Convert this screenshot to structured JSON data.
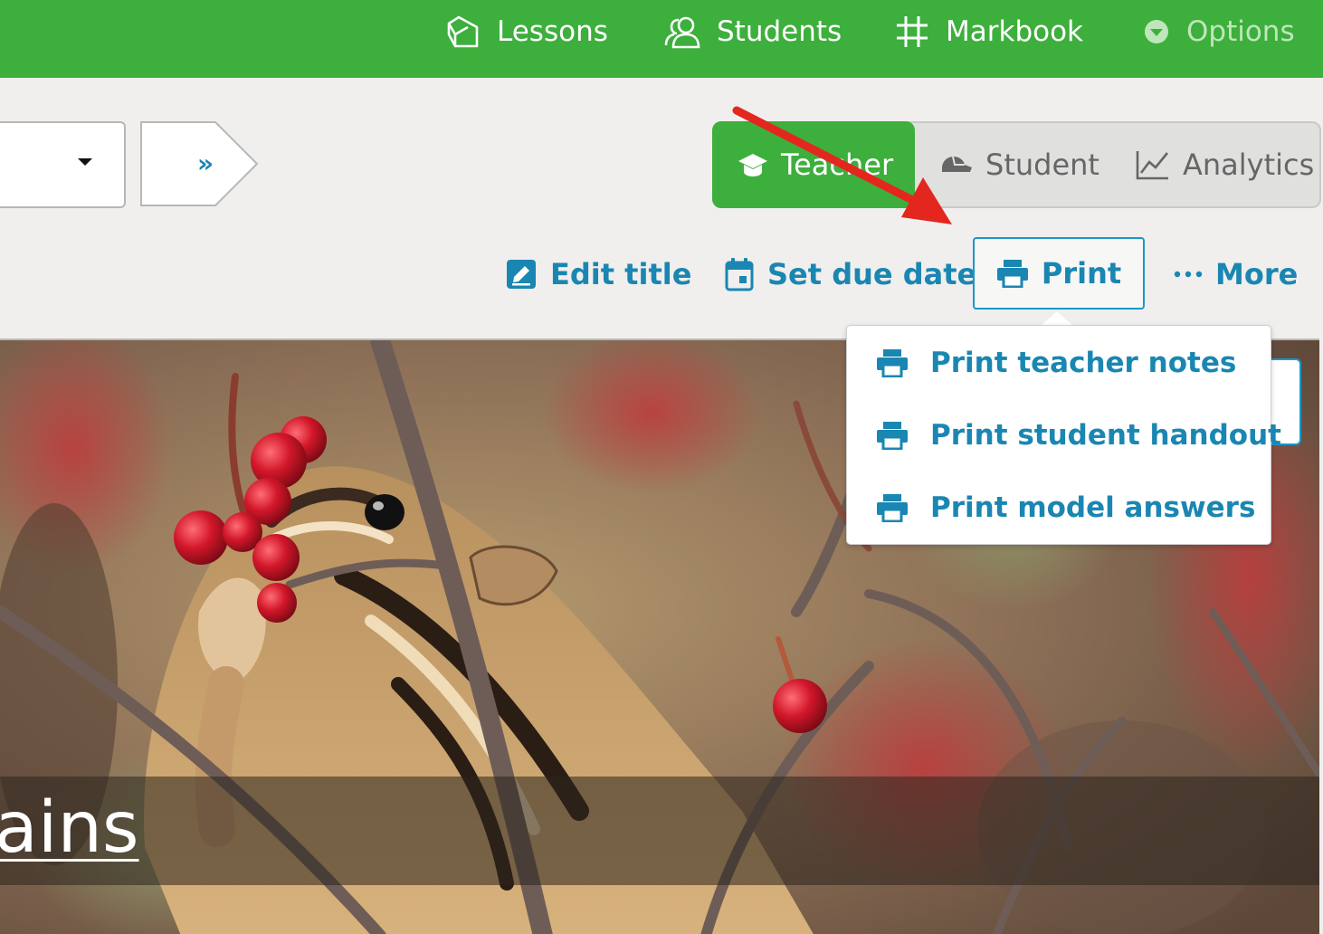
{
  "topnav": {
    "items": [
      {
        "label": "Lessons",
        "icon": "lessons-icon"
      },
      {
        "label": "Students",
        "icon": "students-icon"
      },
      {
        "label": "Markbook",
        "icon": "hash-grid-icon"
      },
      {
        "label": "Options",
        "icon": "chevron-circle-down-icon"
      }
    ]
  },
  "selector": {
    "next_label": "»"
  },
  "view_toggle": {
    "segments": [
      {
        "label": "Teacher",
        "icon": "graduation-cap-icon",
        "active": true
      },
      {
        "label": "Student",
        "icon": "student-cap-icon",
        "active": false
      },
      {
        "label": "Analytics",
        "icon": "line-chart-icon",
        "active": false
      }
    ]
  },
  "actions": {
    "edit_title": "Edit title",
    "set_due_date": "Set due date",
    "print": "Print",
    "more": "More"
  },
  "print_menu": {
    "items": [
      {
        "label": "Print teacher notes",
        "icon": "printer-icon"
      },
      {
        "label": "Print student handout",
        "icon": "printer-icon"
      },
      {
        "label": "Print model answers",
        "icon": "printer-icon"
      }
    ]
  },
  "lesson": {
    "title_fragment": "ains"
  },
  "colors": {
    "nav_green": "#3daf3c",
    "link_blue": "#1a86b2",
    "annotation_red": "#e3271f"
  }
}
